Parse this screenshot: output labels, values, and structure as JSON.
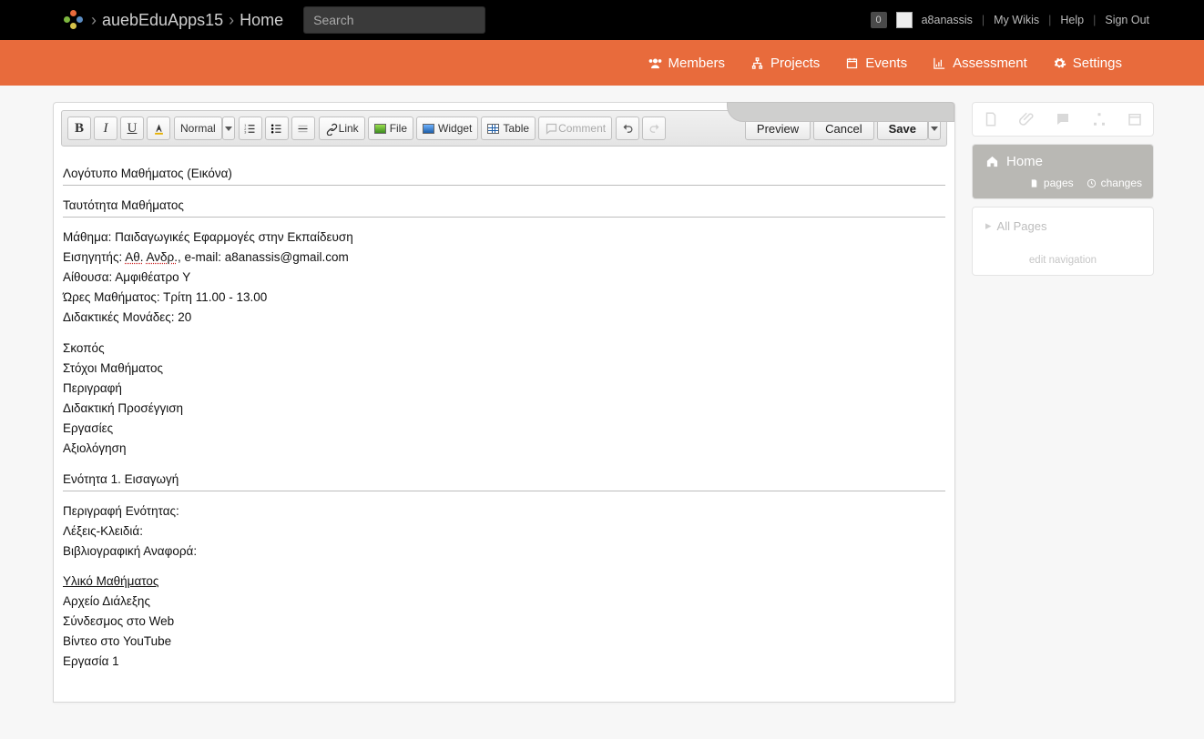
{
  "topbar": {
    "breadcrumb": {
      "wiki": "auebEduApps15",
      "page": "Home",
      "sep": "›"
    },
    "search_placeholder": "Search",
    "notif_count": "0",
    "username": "a8anassis",
    "links": {
      "mywikis": "My Wikis",
      "help": "Help",
      "signout": "Sign Out"
    }
  },
  "nav": {
    "members": "Members",
    "projects": "Projects",
    "events": "Events",
    "assessment": "Assessment",
    "settings": "Settings"
  },
  "toolbar": {
    "style_label": "Normal",
    "link": "Link",
    "file": "File",
    "widget": "Widget",
    "table": "Table",
    "comment": "Comment",
    "preview": "Preview",
    "cancel": "Cancel",
    "save": "Save"
  },
  "content": {
    "h1": "Λογότυπο Μαθήματος (Εικόνα)",
    "h2": "Ταυτότητα Μαθήματος",
    "l1": "Μάθημα: Παιδαγωγικές Εφαρμογές στην Εκπαίδευση",
    "l2a": "Εισηγητής: ",
    "l2b": "Αθ.",
    "l2c": " ",
    "l2d": "Ανδρ.",
    "l2e": ", e-mail: a8anassis@gmail.com",
    "l3": "Αίθουσα: Αμφιθέατρο Υ",
    "l4": "Ώρες Μαθήματος: Τρίτη 11.00 - 13.00",
    "l5": "Διδακτικές Μονάδες: 20",
    "s1": "Σκοπός",
    "s2": "Στόχοι Μαθήματος",
    "s3": "Περιγραφή",
    "s4": "Διδακτική Προσέγγιση",
    "s5": "Εργασίες",
    "s6": "Αξιολόγηση",
    "h3": "Ενότητα 1. Εισαγωγή",
    "u1": "Περιγραφή Ενότητας:",
    "u2": "Λέξεις-Κλειδιά:",
    "u3": "Βιβλιογραφική Αναφορά:",
    "m0": "Υλικό Μαθήματος",
    "m1": "Αρχείο Διάλεξης",
    "m2": "Σύνδεσμος στο Web",
    "m3": "Βίντεο στο YouTube",
    "m4": "Εργασία 1"
  },
  "sidebar": {
    "home": "Home",
    "pages": "pages",
    "changes": "changes",
    "allpages": "All Pages",
    "editnav": "edit navigation"
  }
}
